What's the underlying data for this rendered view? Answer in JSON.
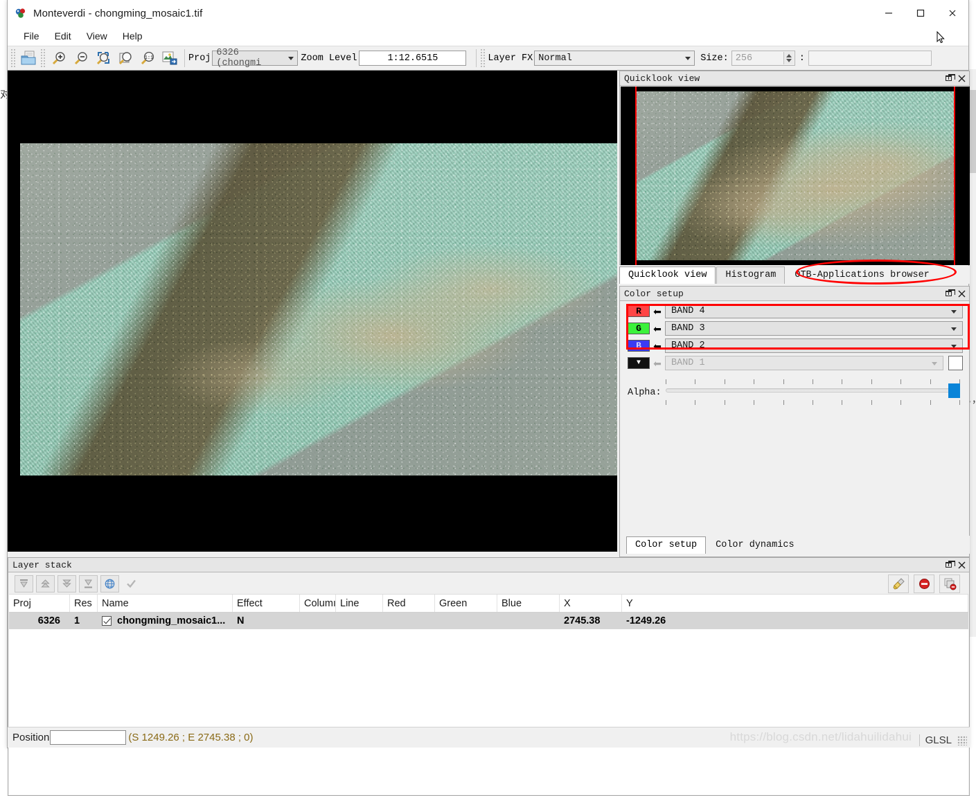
{
  "window": {
    "title": "Monteverdi - chongming_mosaic1.tif",
    "app_icon": "monteverdi-logo-icon",
    "minimize_label": "—",
    "maximize_label": "☐",
    "close_label": "✕"
  },
  "menubar": {
    "items": [
      {
        "label": "File"
      },
      {
        "label": "Edit"
      },
      {
        "label": "View"
      },
      {
        "label": "Help"
      }
    ]
  },
  "toolbar": {
    "buttons": [
      {
        "name": "open-file-button",
        "icon": "open-folder-icon"
      },
      {
        "name": "zoom-in-button",
        "icon": "zoom-in-icon"
      },
      {
        "name": "zoom-out-button",
        "icon": "zoom-out-icon"
      },
      {
        "name": "zoom-to-extent-button",
        "icon": "zoom-extent-icon"
      },
      {
        "name": "zoom-to-layer-button",
        "icon": "zoom-layer-icon"
      },
      {
        "name": "zoom-full-resolution-button",
        "icon": "zoom-one-to-one-icon"
      },
      {
        "name": "export-image-button",
        "icon": "export-image-icon"
      }
    ],
    "proj_label": "Proj",
    "proj_value": "6326 (chongmi",
    "zoom_level_label": "Zoom Level",
    "zoom_level_value": "1:12.6515",
    "layer_fx_label": "Layer FX",
    "layer_fx_value": "Normal",
    "size_label": "Size:",
    "size_value": "256",
    "colon_label": ":",
    "extra_field_value": ""
  },
  "quicklook": {
    "title": "Quicklook view",
    "float_button": "float-icon",
    "close_button": "close-icon"
  },
  "quicklook_tabs": {
    "items": [
      {
        "label": "Quicklook view",
        "active": true
      },
      {
        "label": "Histogram",
        "active": false
      },
      {
        "label": "OTB-Applications browser",
        "active": false,
        "annotated": true
      }
    ]
  },
  "color_setup": {
    "title": "Color setup",
    "bands": [
      {
        "channel": "R",
        "chip_bg": "#ff4545",
        "chip_fg": "#000000",
        "value": "BAND 4",
        "disabled": false
      },
      {
        "channel": "G",
        "chip_bg": "#3bf23b",
        "chip_fg": "#000000",
        "value": "BAND 3",
        "disabled": false
      },
      {
        "channel": "B",
        "chip_bg": "#3b3bf2",
        "chip_fg": "#d0d0ff",
        "value": "BAND 2",
        "disabled": false
      },
      {
        "channel": "▼",
        "chip_bg": "#111111",
        "chip_fg": "#ffffff",
        "value": "BAND 1",
        "disabled": true
      }
    ],
    "alpha_label": "Alpha:",
    "alpha_value": 100,
    "alpha_min": 0,
    "alpha_max": 100,
    "tab_items": [
      {
        "label": "Color setup",
        "active": true
      },
      {
        "label": "Color dynamics",
        "active": false
      }
    ]
  },
  "layer_stack": {
    "title": "Layer stack",
    "toolbar_buttons": [
      {
        "name": "move-to-top-button",
        "icon": "move-top-icon"
      },
      {
        "name": "move-up-button",
        "icon": "move-up-icon"
      },
      {
        "name": "move-down-button",
        "icon": "move-down-icon"
      },
      {
        "name": "move-to-bottom-button",
        "icon": "move-bottom-icon"
      },
      {
        "name": "projection-button",
        "icon": "globe-icon"
      },
      {
        "name": "apply-button",
        "icon": "check-icon"
      }
    ],
    "right_buttons": [
      {
        "name": "clean-layers-button",
        "icon": "broom-icon"
      },
      {
        "name": "delete-layer-button",
        "icon": "delete-circle-icon"
      },
      {
        "name": "delete-all-layers-button",
        "icon": "delete-all-layers-icon"
      }
    ],
    "columns": [
      "Proj",
      "Res",
      "Name",
      "Effect",
      "Columı",
      "Line",
      "Red",
      "Green",
      "Blue",
      "X",
      "Y"
    ],
    "rows": [
      {
        "proj": "6326",
        "res": "1",
        "name": "chongming_mosaic1...",
        "effect": "N",
        "column": "",
        "line": "",
        "red": "",
        "green": "",
        "blue": "",
        "x": "2745.38",
        "y": "-1249.26",
        "checked": true
      }
    ]
  },
  "statusbar": {
    "position_label": "Position",
    "position_value": "",
    "coords": "(S 1249.26 ; E 2745.38 ; 0)",
    "watermark": "https://blog.csdn.net/lidahuilidahui",
    "render_mode": "GLSL"
  },
  "background": {
    "left_text": "对g当员－å中所on",
    "right_text": "t，，，，，"
  },
  "colors": {
    "accent_red": "#ff0000",
    "alpha_handle": "#0a84d8",
    "status_text": "#8a6a16",
    "row_select": "#d5d5d5"
  }
}
